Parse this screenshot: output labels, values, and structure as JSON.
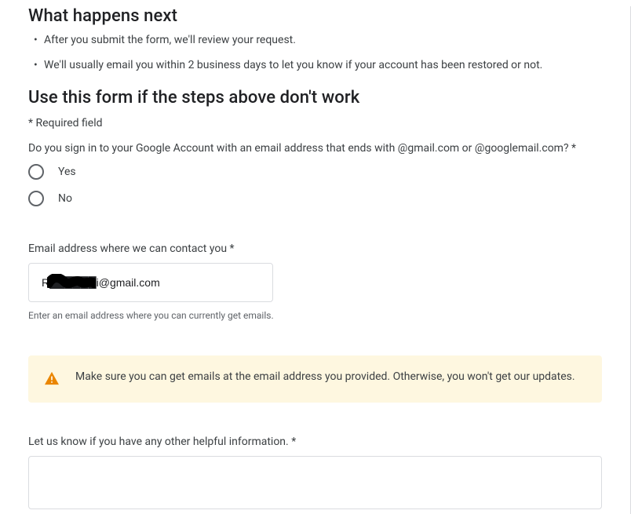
{
  "section1": {
    "heading": "What happens next",
    "bullets": [
      "After you submit the form, we'll review your request.",
      "We'll usually email you within 2 business days to let you know if your account has been restored or not."
    ]
  },
  "section2": {
    "heading": "Use this form if the steps above don't work",
    "required_note": "* Required field",
    "signin_question": "Do you sign in to your Google Account with an email address that ends with @gmail.com or @googlemail.com? *",
    "radio_yes": "Yes",
    "radio_no": "No"
  },
  "contact": {
    "label": "Email address where we can contact you *",
    "value": "R██████i@gmail.com",
    "helper": "Enter an email address where you can currently get emails."
  },
  "warning": {
    "text": "Make sure you can get emails at the email address you provided. Otherwise, you won't get our updates."
  },
  "other_info": {
    "label": "Let us know if you have any other helpful information. *",
    "value": ""
  }
}
